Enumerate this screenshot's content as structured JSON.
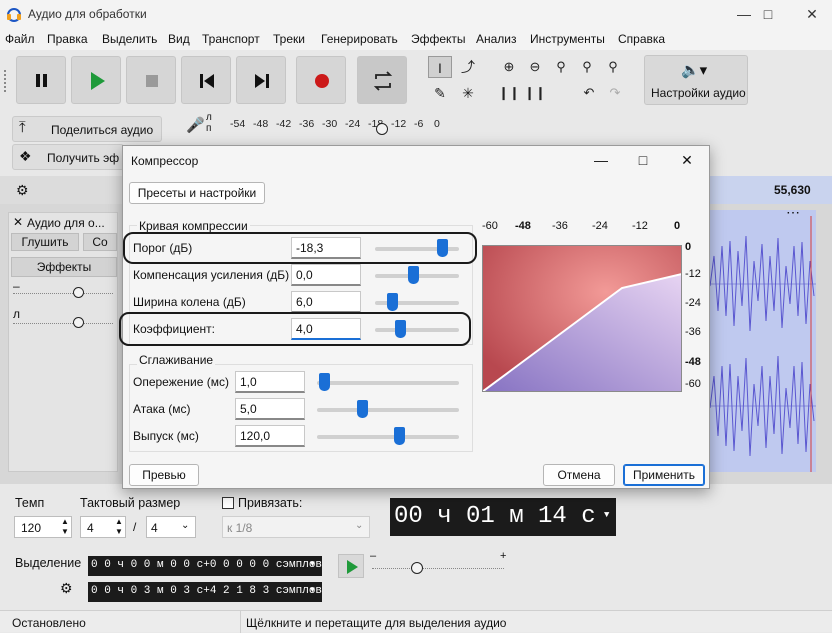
{
  "window": {
    "title": "Аудио для обработки"
  },
  "menu": [
    "Файл",
    "Правка",
    "Выделить",
    "Вид",
    "Транспорт",
    "Треки",
    "Генерировать",
    "Эффекты",
    "Анализ",
    "Инструменты",
    "Справка"
  ],
  "toolbar": {
    "audio_settings": "Настройки аудио"
  },
  "row2": {
    "share": "Поделиться аудио",
    "get_effects": "Получить эф",
    "meter_l": "л",
    "meter_r": "п",
    "meter_ticks": [
      "-54",
      "-48",
      "-42",
      "-36",
      "-30",
      "-24",
      "-18",
      "-12",
      "-6",
      "0"
    ]
  },
  "ruler": {
    "time_right": "55,630"
  },
  "track": {
    "name": "Аудио для о...",
    "mute": "Глушить",
    "solo": "Со",
    "effects": "Эффекты",
    "gain_minus": "–",
    "pan_l": "л"
  },
  "bottom": {
    "tempo_label": "Темп",
    "tempo_value": "120",
    "timesig_label": "Тактовый размер",
    "timesig_num": "4",
    "timesig_sep": "/",
    "timesig_den": "4",
    "snap_label": "Привязать:",
    "snap_value": "к 1/8",
    "big_time": "00 ч 01 м 14 с",
    "selection_label": "Выделение",
    "sel_start": "0 0 ч 0 0 м 0 0 с+0 0 0 0 0 сэмплов",
    "sel_end": "0 0 ч 0 3 м 0 3 с+4 2 1 8 3 сэмплов",
    "play_minus": "–",
    "play_plus": "+"
  },
  "status": {
    "left": "Остановлено",
    "right": "Щёлкните и перетащите для выделения аудио"
  },
  "dialog": {
    "title": "Компрессор",
    "presets_btn": "Пресеты и настройки",
    "curve_section": "Кривая компрессии",
    "smooth_section": "Сглаживание",
    "params": [
      {
        "label": "Порог (дБ)",
        "value": "-18,3",
        "slider": 0.8
      },
      {
        "label": "Компенсация усиления (дБ)",
        "value": "0,0",
        "slider": 0.45
      },
      {
        "label": "Ширина колена (дБ)",
        "value": "6,0",
        "slider": 0.2
      },
      {
        "label": "Коэффициент:",
        "value": "4,0",
        "slider": 0.3
      }
    ],
    "smooth": [
      {
        "label": "Опережение (мс)",
        "value": "1,0",
        "slider": 0.05
      },
      {
        "label": "Атака (мс)",
        "value": "5,0",
        "slider": 0.32
      },
      {
        "label": "Выпуск (мс)",
        "value": "120,0",
        "slider": 0.58
      }
    ],
    "graph_x_ticks": [
      "-60",
      "-48",
      "-36",
      "-24",
      "-12",
      "0"
    ],
    "graph_y_ticks": [
      "0",
      "-12",
      "-24",
      "-36",
      "-48",
      "-60"
    ],
    "preview_btn": "Превью",
    "cancel_btn": "Отмена",
    "apply_btn": "Применить"
  }
}
